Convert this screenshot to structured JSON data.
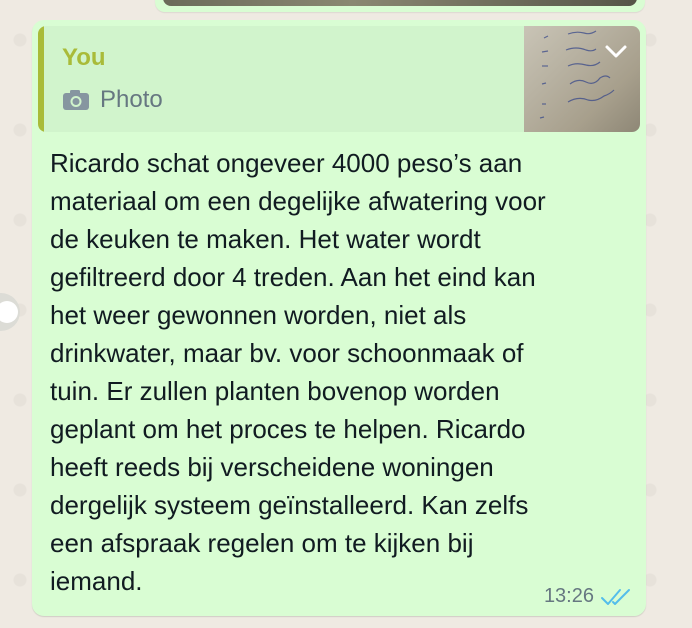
{
  "message": {
    "quote": {
      "author": "You",
      "type_label": "Photo",
      "icon": "camera-icon"
    },
    "text": "Ricardo schat ongeveer 4000 peso’s aan\nmateriaal om een degelijke afwatering voor\nde keuken te maken. Het water wordt\ngefiltreerd door 4 treden. Aan het eind kan\nhet weer gewonnen worden, niet als\ndrinkwater, maar bv. voor schoonmaak of\ntuin. Er zullen planten bovenop worden\ngeplant om het proces te helpen. Ricardo\nheeft reeds bij verscheidene woningen\ndergelijk systeem geïnstalleerd. Kan zelfs\neen afspraak regelen om te kijken bij\niemand.",
    "time": "13:26",
    "status": "read",
    "status_icon": "double-check-icon"
  },
  "colors": {
    "bubble": "#d9fdd3",
    "quote_accent": "#a9bb39",
    "read_ticks": "#53bdeb",
    "background": "#efeae2"
  }
}
